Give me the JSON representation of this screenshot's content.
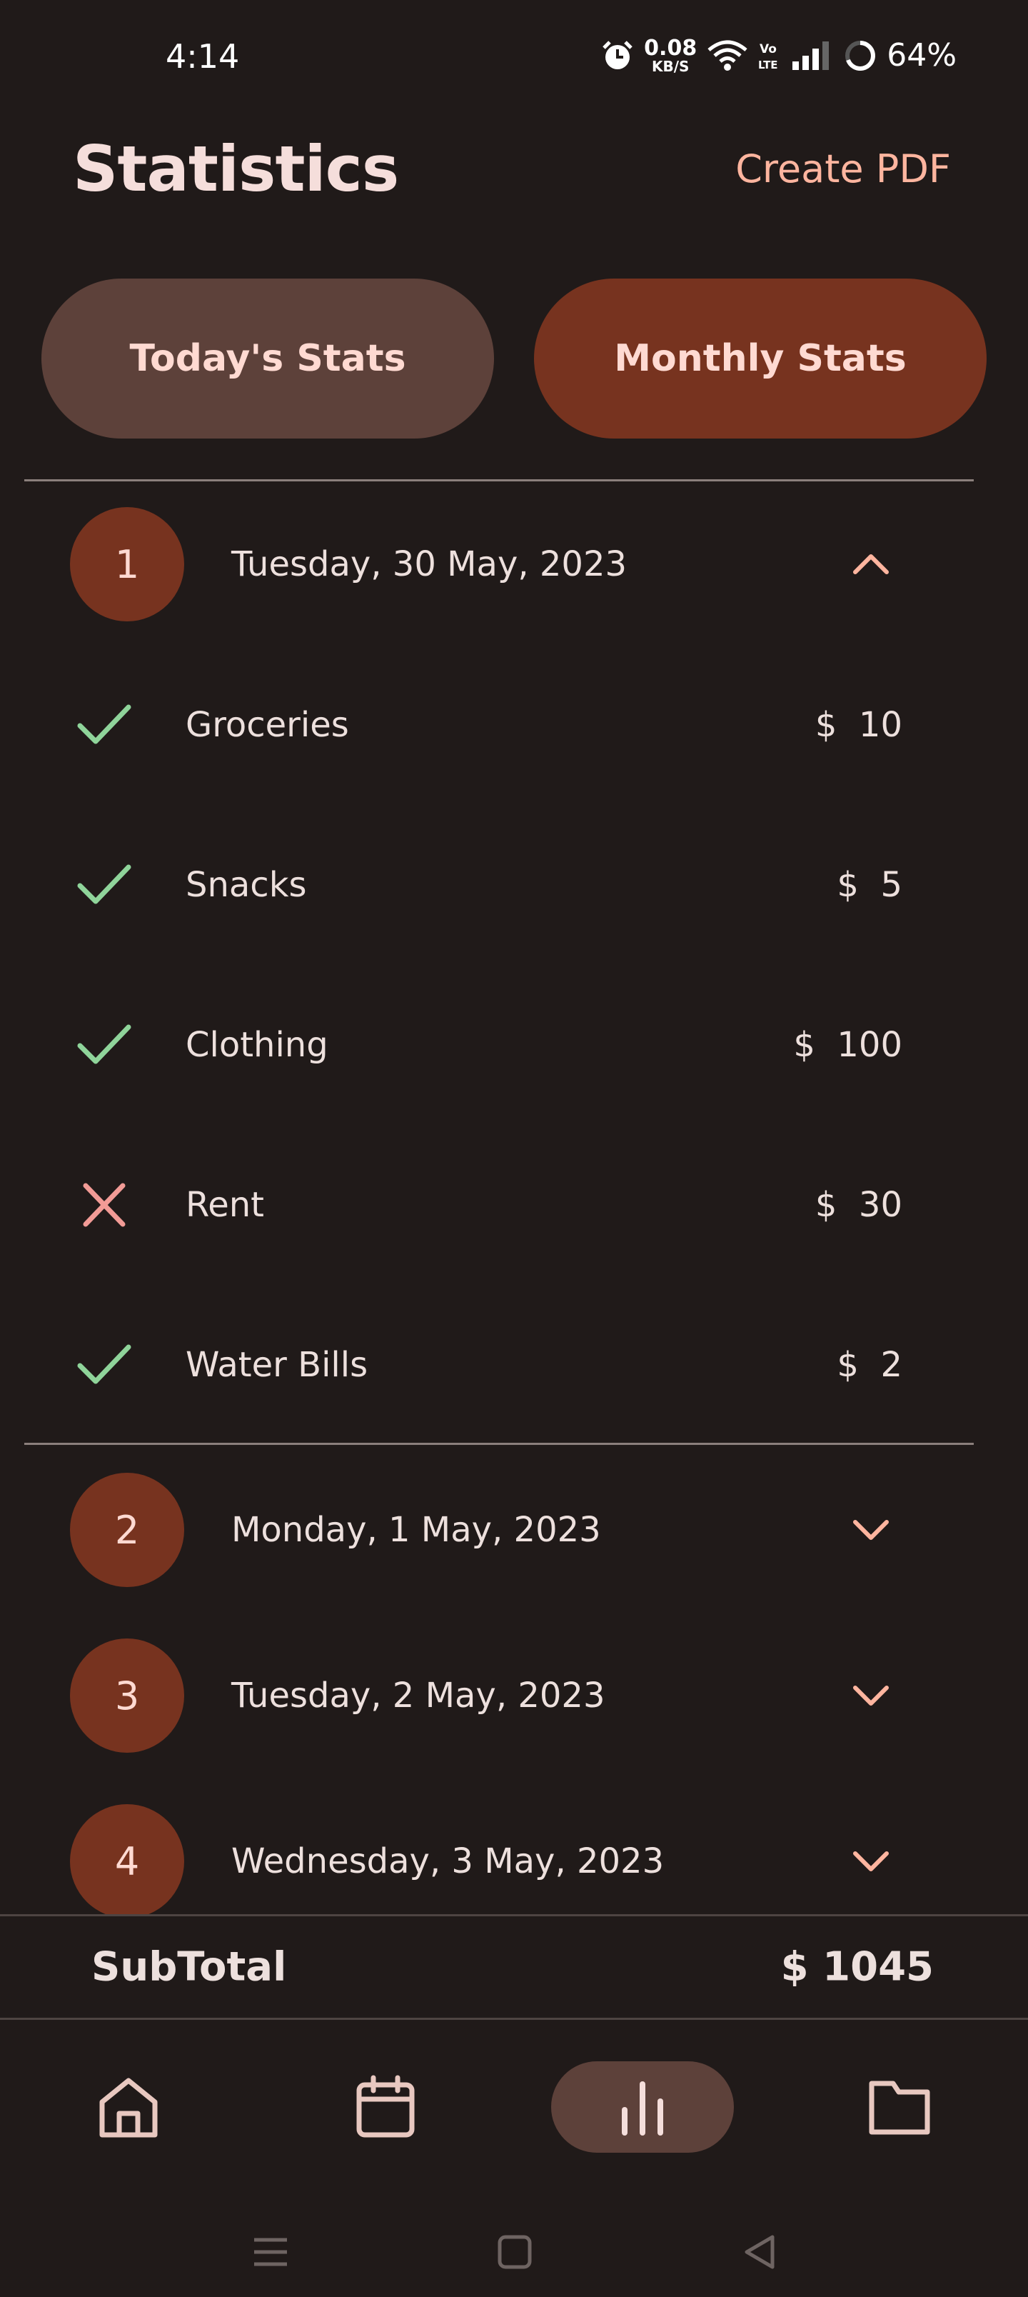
{
  "status_bar": {
    "time": "4:14",
    "net_speed_value": "0.08",
    "net_speed_unit": "KB/S",
    "network_type": "Vo LTE",
    "battery": "64%",
    "icons": [
      "alarm-icon",
      "wifi-icon",
      "volte-icon",
      "signal-icon",
      "battery-icon"
    ]
  },
  "header": {
    "title": "Statistics",
    "create_pdf_label": "Create PDF"
  },
  "tabs": {
    "today_label": "Today's Stats",
    "monthly_label": "Monthly Stats",
    "active": "monthly"
  },
  "days": [
    {
      "index": "1",
      "date": "Tuesday, 30 May, 2023",
      "expanded": true,
      "items": [
        {
          "name": "Groceries",
          "amount": "$  10",
          "paid": true
        },
        {
          "name": "Snacks",
          "amount": "$  5",
          "paid": true
        },
        {
          "name": "Clothing",
          "amount": "$  100",
          "paid": true
        },
        {
          "name": "Rent",
          "amount": "$  30",
          "paid": false
        },
        {
          "name": "Water Bills",
          "amount": "$  2",
          "paid": true
        }
      ]
    },
    {
      "index": "2",
      "date": "Monday, 1 May, 2023",
      "expanded": false
    },
    {
      "index": "3",
      "date": "Tuesday, 2 May, 2023",
      "expanded": false
    },
    {
      "index": "4",
      "date": "Wednesday, 3 May, 2023",
      "expanded": false
    }
  ],
  "subtotal": {
    "label": "SubTotal",
    "value": "$ 1045"
  },
  "bottom_nav": {
    "items": [
      "home-icon",
      "calendar-icon",
      "bar-chart-icon",
      "folder-icon"
    ],
    "active": "bar-chart-icon"
  },
  "colors": {
    "background": "#201a19",
    "accent": "#77331f",
    "tab_inactive": "#5d413a",
    "link": "#ffb59f",
    "paid_check": "#8fd49a",
    "unpaid_cross": "#f29b96"
  }
}
